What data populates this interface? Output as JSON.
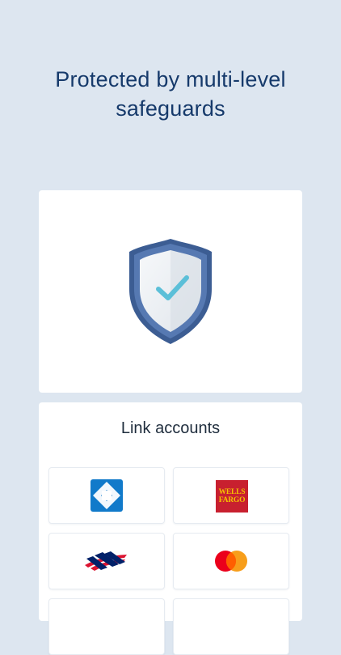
{
  "headline": "Protected by multi-level safeguards",
  "security_card": {
    "icon": "shield-check-icon"
  },
  "link_accounts": {
    "title": "Link accounts",
    "tiles": [
      {
        "icon": "chase-logo",
        "brand_color": "#117aca"
      },
      {
        "icon": "wells-fargo-logo",
        "brand_color": "#c8202f",
        "line1": "WELLS",
        "line2": "FARGO"
      },
      {
        "icon": "bank-of-america-logo",
        "brand_color": "#dc1431"
      },
      {
        "icon": "mastercard-logo",
        "brand_color": "#eb001b"
      }
    ]
  },
  "colors": {
    "background": "#dde6f0",
    "headline": "#163a6b",
    "card": "#ffffff",
    "check": "#5bbfd8"
  }
}
